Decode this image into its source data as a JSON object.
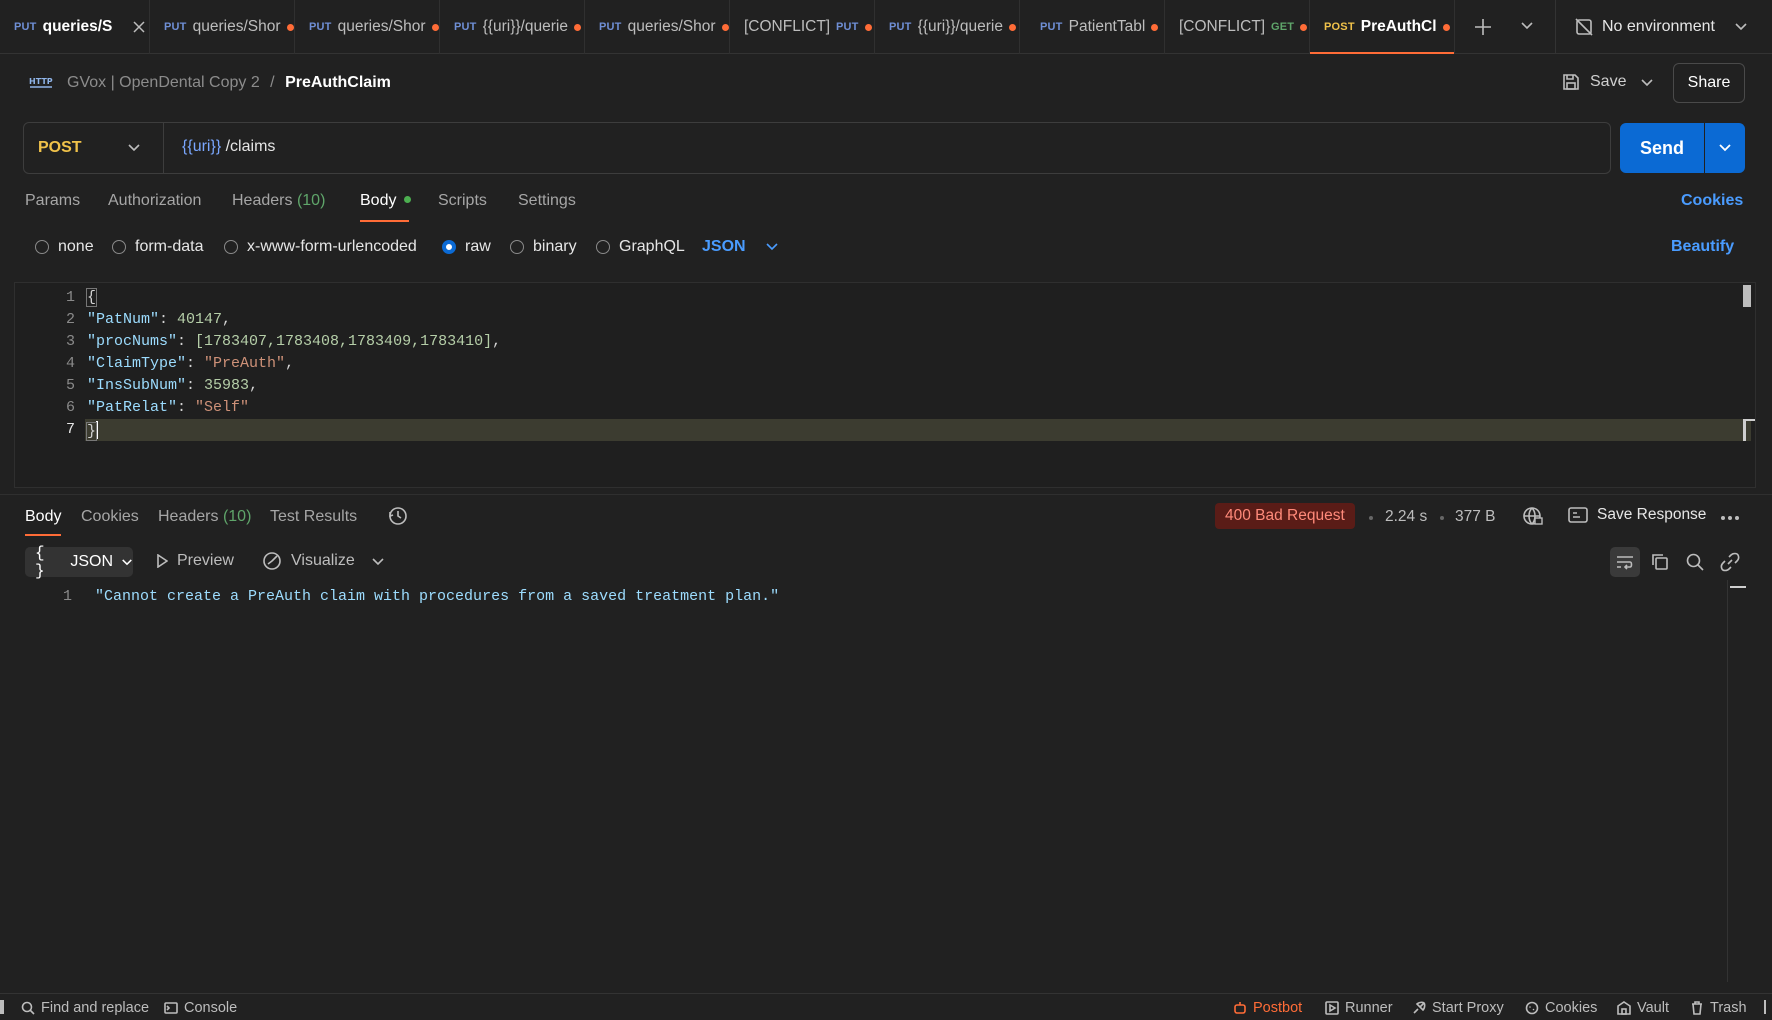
{
  "tabs": [
    {
      "method": "PUT",
      "title": "queries/Sh",
      "active": false,
      "closable": true
    },
    {
      "method": "PUT",
      "title": "queries/Shor",
      "active": false
    },
    {
      "method": "PUT",
      "title": "queries/Shor",
      "active": false
    },
    {
      "method": "PUT",
      "title": "{{uri}}/querie",
      "active": false
    },
    {
      "method": "PUT",
      "title": "queries/Shor",
      "active": false
    },
    {
      "prefix": "[CONFLICT]",
      "method": "PUT",
      "active": false
    },
    {
      "method": "PUT",
      "title": "{{uri}}/querie",
      "active": false
    },
    {
      "method": "PUT",
      "title": "PatientTabl",
      "active": false
    },
    {
      "prefix": "[CONFLICT]",
      "method": "GET",
      "active": false
    },
    {
      "method": "POST",
      "title": "PreAuthClai",
      "active": true
    }
  ],
  "environment": "No environment",
  "breadcrumb": {
    "workspace": "GVox | OpenDental Copy 2",
    "separator": "/",
    "request": "PreAuthClaim"
  },
  "header": {
    "save_label": "Save",
    "share_label": "Share"
  },
  "request": {
    "method": "POST",
    "url_variable": "{{uri}}",
    "url_path": "/claims",
    "send_label": "Send"
  },
  "request_tabs": {
    "params": "Params",
    "authorization": "Authorization",
    "headers": "Headers",
    "headers_count": "(10)",
    "body": "Body",
    "scripts": "Scripts",
    "settings": "Settings",
    "cookies": "Cookies"
  },
  "body_types": {
    "none": "none",
    "form_data": "form-data",
    "urlencoded": "x-www-form-urlencoded",
    "raw": "raw",
    "binary": "binary",
    "graphql": "GraphQL",
    "selected": "raw",
    "language": "JSON",
    "beautify": "Beautify"
  },
  "editor": {
    "line_numbers": [
      "1",
      "2",
      "3",
      "4",
      "5",
      "6",
      "7"
    ],
    "open_brace": "{",
    "patnum_key": "\"PatNum\"",
    "patnum_val": "40147",
    "procnums_key": "\"procNums\"",
    "procnums_val": "[1783407,1783408,1783409,1783410]",
    "claimtype_key": "\"ClaimType\"",
    "claimtype_val": "\"PreAuth\"",
    "inssubnum_key": "\"InsSubNum\"",
    "inssubnum_val": "35983",
    "patrelat_key": "\"PatRelat\"",
    "patrelat_val": "\"Self\"",
    "close_brace": "}"
  },
  "response": {
    "tabs": {
      "body": "Body",
      "cookies": "Cookies",
      "headers": "Headers",
      "headers_count": "(10)",
      "tests": "Test Results"
    },
    "status": "400 Bad Request",
    "time": "2.24 s",
    "size": "377 B",
    "save_response": "Save Response",
    "format": "JSON",
    "preview": "Preview",
    "visualize": "Visualize",
    "line_number": "1",
    "message": "\"Cannot create a PreAuth claim with procedures from a saved treatment plan.\""
  },
  "footer": {
    "find_replace": "Find and replace",
    "console": "Console",
    "postbot": "Postbot",
    "runner": "Runner",
    "start_proxy": "Start Proxy",
    "cookies": "Cookies",
    "vault": "Vault",
    "trash": "Trash"
  },
  "colors": {
    "accent": "#ff6c37",
    "send": "#0b6ad4",
    "post": "#f0c24a",
    "error_bg": "#5a1c17",
    "link": "#4a9cff"
  },
  "icons": [
    "close-icon",
    "plus-icon",
    "chevron-down-icon",
    "no-environment-icon",
    "http-icon",
    "save-icon",
    "history-icon",
    "globe-icon",
    "save-response-icon",
    "more-icon",
    "wrap-icon",
    "copy-icon",
    "search-icon",
    "link-icon",
    "play-icon",
    "visualize-icon",
    "console-icon",
    "postbot-icon",
    "runner-icon",
    "proxy-icon",
    "cookie-icon",
    "vault-icon",
    "trash-icon"
  ]
}
